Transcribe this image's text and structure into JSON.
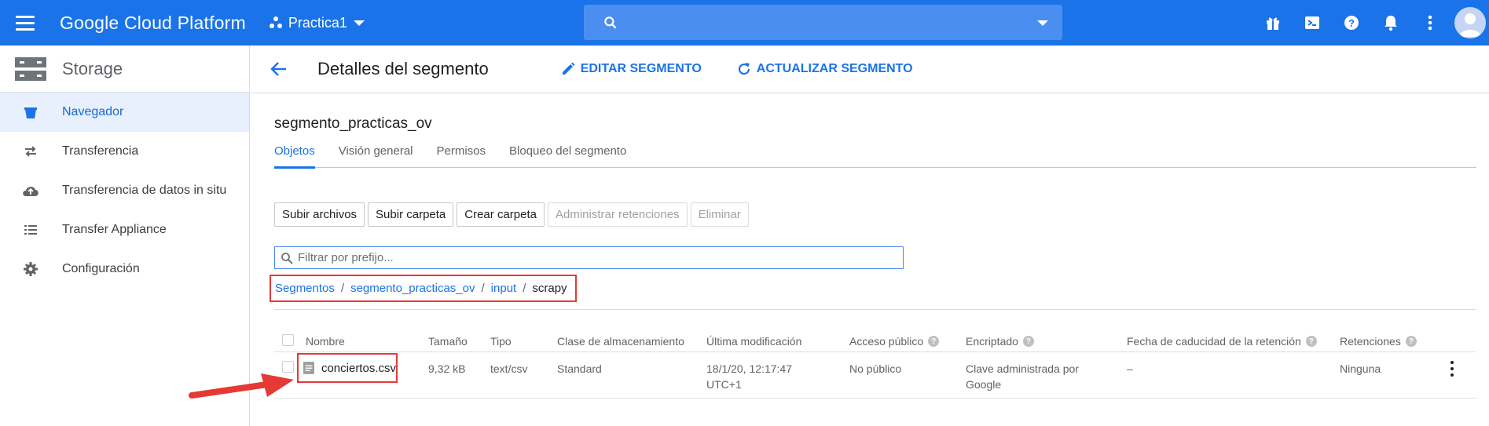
{
  "topbar": {
    "brand": "Google Cloud Platform",
    "project": "Practica1",
    "icons": [
      "menu-icon",
      "gift-icon",
      "cloud-shell-icon",
      "help-icon",
      "notifications-icon",
      "more-vert-icon",
      "account-avatar"
    ]
  },
  "sidebar": {
    "title": "Storage",
    "items": [
      {
        "label": "Navegador",
        "icon": "bucket-icon",
        "active": true
      },
      {
        "label": "Transferencia",
        "icon": "transfer-arrows-icon",
        "active": false
      },
      {
        "label": "Transferencia de datos in situ",
        "icon": "cloud-upload-icon",
        "active": false
      },
      {
        "label": "Transfer Appliance",
        "icon": "list-icon",
        "active": false
      },
      {
        "label": "Configuración",
        "icon": "gear-icon",
        "active": false
      }
    ]
  },
  "page": {
    "title": "Detalles del segmento",
    "edit_label": "EDITAR SEGMENTO",
    "refresh_label": "ACTUALIZAR SEGMENTO",
    "bucket_name": "segmento_practicas_ov"
  },
  "tabs": [
    {
      "label": "Objetos",
      "active": true
    },
    {
      "label": "Visión general",
      "active": false
    },
    {
      "label": "Permisos",
      "active": false
    },
    {
      "label": "Bloqueo del segmento",
      "active": false
    }
  ],
  "toolbar": {
    "upload_files": "Subir archivos",
    "upload_folder": "Subir carpeta",
    "create_folder": "Crear carpeta",
    "manage_retention": "Administrar retenciones",
    "delete": "Eliminar"
  },
  "filter": {
    "placeholder": "Filtrar por prefijo..."
  },
  "breadcrumb": {
    "root": "Segmentos",
    "bucket": "segmento_practicas_ov",
    "folder": "input",
    "current": "scrapy",
    "separator": "/"
  },
  "table": {
    "headers": {
      "name": "Nombre",
      "size": "Tamaño",
      "type": "Tipo",
      "storage_class": "Clase de almacenamiento",
      "modified": "Última modificación",
      "public_access": "Acceso público",
      "encryption": "Encriptado",
      "retention_expiry": "Fecha de caducidad de la retención",
      "holds": "Retenciones"
    },
    "rows": [
      {
        "name": "conciertos.csv",
        "size": "9,32 kB",
        "type": "text/csv",
        "storage_class": "Standard",
        "modified_line1": "18/1/20, 12:17:47",
        "modified_line2": "UTC+1",
        "public_access": "No público",
        "encryption_line1": "Clave administrada por",
        "encryption_line2": "Google",
        "retention_expiry": "–",
        "holds": "Ninguna"
      }
    ]
  },
  "colors": {
    "accent": "#1a73e8",
    "highlight": "#e53935"
  }
}
